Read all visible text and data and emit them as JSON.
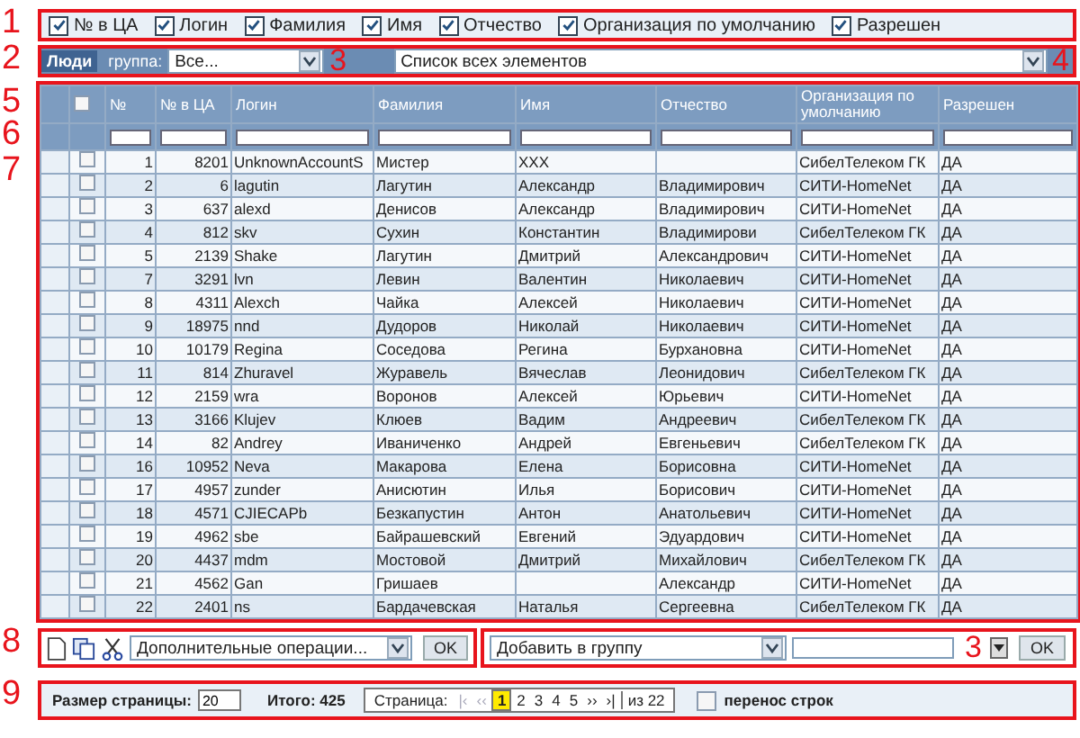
{
  "column_toggles": {
    "callout": "1",
    "items": [
      {
        "label": "№ в ЦА",
        "checked": true
      },
      {
        "label": "Логин",
        "checked": true
      },
      {
        "label": "Фамилия",
        "checked": true
      },
      {
        "label": "Имя",
        "checked": true
      },
      {
        "label": "Отчество",
        "checked": true
      },
      {
        "label": "Организация по умолчанию",
        "checked": true
      },
      {
        "label": "Разрешен",
        "checked": true
      }
    ]
  },
  "group_bar": {
    "callout": "2",
    "section_label": "Люди",
    "group_label": "группа:",
    "group_value": "Все...",
    "group_callout": "3",
    "list_value": "Список всех элементов",
    "list_callout": "4"
  },
  "table": {
    "header_callout": "5",
    "filter_callout": "6",
    "rows_callout": "7",
    "select_all_checked": false,
    "columns": [
      "№",
      "№ в ЦА",
      "Логин",
      "Фамилия",
      "Имя",
      "Отчество",
      "Организация по умолчанию",
      "Разрешен"
    ],
    "rows": [
      {
        "checked": false,
        "cells": [
          "1",
          "8201",
          "UnknownAccountS",
          "Мистер",
          "XXX",
          "",
          "СибелТелеком ГК",
          "ДА"
        ]
      },
      {
        "checked": false,
        "cells": [
          "2",
          "6",
          "lagutin",
          "Лагутин",
          "Александр",
          "Владимирович",
          "СИТИ-HomeNet",
          "ДА"
        ]
      },
      {
        "checked": false,
        "cells": [
          "3",
          "637",
          "alexd",
          "Денисов",
          "Александр",
          "Владимирович",
          "СИТИ-HomeNet",
          "ДА"
        ]
      },
      {
        "checked": false,
        "cells": [
          "4",
          "812",
          "skv",
          "Сухин",
          "Константин",
          "Владимирови",
          "СибелТелеком ГК",
          "ДА"
        ]
      },
      {
        "checked": false,
        "cells": [
          "5",
          "2139",
          "Shake",
          "Лагутин",
          "Дмитрий",
          "Александрович",
          "СИТИ-HomeNet",
          "ДА"
        ]
      },
      {
        "checked": false,
        "cells": [
          "7",
          "3291",
          "lvn",
          "Левин",
          "Валентин",
          "Николаевич",
          "СИТИ-HomeNet",
          "ДА"
        ]
      },
      {
        "checked": false,
        "cells": [
          "8",
          "4311",
          "Alexch",
          "Чайка",
          "Алексей",
          "Николаевич",
          "СИТИ-HomeNet",
          "ДА"
        ]
      },
      {
        "checked": false,
        "cells": [
          "9",
          "18975",
          "nnd",
          "Дудоров",
          "Николай",
          "Николаевич",
          "СИТИ-HomeNet",
          "ДА"
        ]
      },
      {
        "checked": false,
        "cells": [
          "10",
          "10179",
          "Regina",
          "Соседова",
          "Регина",
          "Бурхановна",
          "СИТИ-HomeNet",
          "ДА"
        ]
      },
      {
        "checked": false,
        "cells": [
          "11",
          "814",
          "Zhuravel",
          "Журавель",
          "Вячеслав",
          "Леонидович",
          "СибелТелеком ГК",
          "ДА"
        ]
      },
      {
        "checked": false,
        "cells": [
          "12",
          "2159",
          "wra",
          "Воронов",
          "Алексей",
          "Юрьевич",
          "СИТИ-HomeNet",
          "ДА"
        ]
      },
      {
        "checked": false,
        "cells": [
          "13",
          "3166",
          "Klujev",
          "Клюев",
          "Вадим",
          "Андреевич",
          "СибелТелеком ГК",
          "ДА"
        ]
      },
      {
        "checked": false,
        "cells": [
          "14",
          "82",
          "Andrey",
          "Иваниченко",
          "Андрей",
          "Евгеньевич",
          "СибелТелеком ГК",
          "ДА"
        ]
      },
      {
        "checked": false,
        "cells": [
          "16",
          "10952",
          "Neva",
          "Макарова",
          "Елена",
          "Борисовна",
          "СИТИ-HomeNet",
          "ДА"
        ]
      },
      {
        "checked": false,
        "cells": [
          "17",
          "4957",
          "zunder",
          "Анисютин",
          "Илья",
          "Борисович",
          "СИТИ-HomeNet",
          "ДА"
        ]
      },
      {
        "checked": false,
        "cells": [
          "18",
          "4571",
          "CJIECAPb",
          "Безкапустин",
          "Антон",
          "Анатольевич",
          "СИТИ-HomeNet",
          "ДА"
        ]
      },
      {
        "checked": false,
        "cells": [
          "19",
          "4962",
          "sbe",
          "Байрашевский",
          "Евгений",
          "Эдуардович",
          "СИТИ-HomeNet",
          "ДА"
        ]
      },
      {
        "checked": false,
        "cells": [
          "20",
          "4437",
          "mdm",
          "Мостовой",
          "Дмитрий",
          "Михайлович",
          "СибелТелеком ГК",
          "ДА"
        ]
      },
      {
        "checked": false,
        "cells": [
          "21",
          "4562",
          "Gan",
          "Гришаев",
          "",
          "Александр",
          "СИТИ-HomeNet",
          "ДА"
        ]
      },
      {
        "checked": false,
        "cells": [
          "22",
          "2401",
          "ns",
          "Бардачевская",
          "Наталья",
          "Сергеевна",
          "СибелТелеком ГК",
          "ДА"
        ]
      }
    ]
  },
  "actions": {
    "callout": "8",
    "operations_value": "Дополнительные операции...",
    "ok": "OK",
    "add_value": "Добавить в группу",
    "add_callout": "3",
    "ok2": "OK"
  },
  "footer": {
    "callout": "9",
    "page_size_label": "Размер страницы:",
    "page_size": "20",
    "total": "Итого: 425",
    "page_label": "Страница:",
    "first": "|‹",
    "prev": "‹‹",
    "pages": [
      {
        "label": "1",
        "selected": true
      },
      {
        "label": "2",
        "selected": false
      },
      {
        "label": "3",
        "selected": false
      },
      {
        "label": "4",
        "selected": false
      },
      {
        "label": "5",
        "selected": false
      }
    ],
    "next": "››",
    "last": "›|",
    "of": "из 22",
    "wrap_label": "перенос строк",
    "wrap_checked": false
  }
}
